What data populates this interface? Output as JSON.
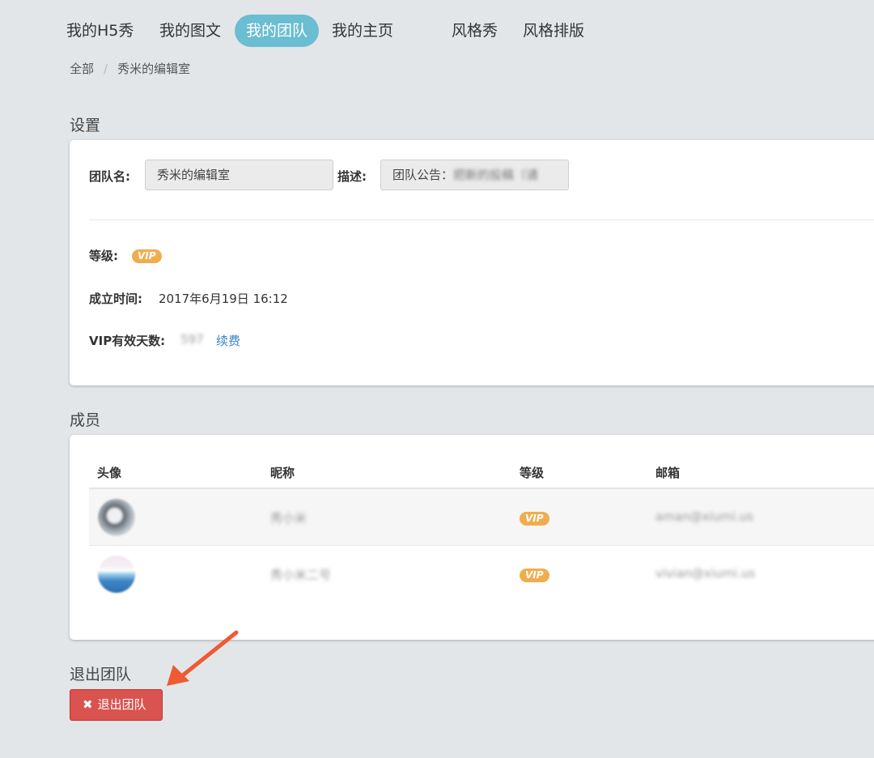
{
  "nav": {
    "items": [
      {
        "label": "我的H5秀"
      },
      {
        "label": "我的图文"
      },
      {
        "label": "我的团队"
      },
      {
        "label": "我的主页"
      },
      {
        "label": "风格秀"
      },
      {
        "label": "风格排版"
      }
    ],
    "active": "我的团队"
  },
  "breadcrumb": {
    "items": [
      "全部",
      "秀米的编辑室"
    ],
    "separator": "/"
  },
  "settings": {
    "title": "设置",
    "team_name_label": "团队名:",
    "team_name_value": "秀米的编辑室",
    "desc_label": "描述:",
    "desc_value": "团队公告：",
    "desc_value_blurred": "把新的投稿（请",
    "level_label": "等级:",
    "level_badge": "VIP",
    "created_label": "成立时间:",
    "created_value": "2017年6月19日 16:12",
    "vip_days_label": "VIP有效天数:",
    "vip_days_value": "597",
    "renew_link": "续费"
  },
  "members": {
    "title": "成员",
    "columns": [
      "头像",
      "昵称",
      "等级",
      "邮箱"
    ],
    "rows": [
      {
        "avatar_icon": "cat-avatar",
        "nickname": "秀小米",
        "level": "VIP",
        "email": "aman@xiumi.us"
      },
      {
        "avatar_icon": "sea-avatar",
        "nickname": "秀小米二号",
        "level": "VIP",
        "email": "vivian@xiumi.us"
      }
    ]
  },
  "exit": {
    "title": "退出团队",
    "button_label": "退出团队",
    "button_icon": "close-icon"
  },
  "colors": {
    "accent": "#6bbdd1",
    "vip": "#f0ad4e",
    "danger": "#d9534f",
    "link": "#3a82c4",
    "annotation_arrow": "#ee5a32"
  }
}
